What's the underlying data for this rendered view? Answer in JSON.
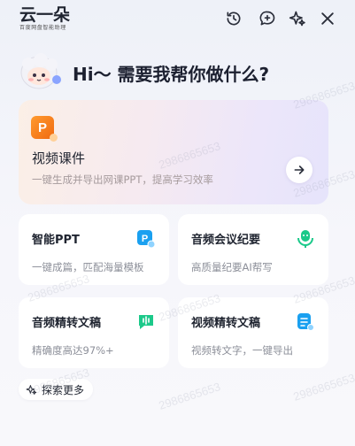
{
  "header": {
    "logo_text": "云一朵",
    "logo_sub": "百度网盘智能助理",
    "icons": [
      "history-icon",
      "new-chat-icon",
      "sparkle-icon",
      "close-icon"
    ]
  },
  "greeting": "Hi～ 需要我帮你做什么?",
  "hero": {
    "icon_letter": "P",
    "title": "视频课件",
    "subtitle": "一键生成并导出网课PPT，提高学习效率"
  },
  "cards": [
    {
      "title": "智能PPT",
      "desc": "一键成篇，匹配海量模板",
      "icon": "ppt-icon",
      "color": "#1aa0f0"
    },
    {
      "title": "音频会议纪要",
      "desc": "高质量纪要AI帮写",
      "icon": "mic-icon",
      "color": "#1cc98a"
    },
    {
      "title": "音频精转文稿",
      "desc": "精确度高达97%+",
      "icon": "audio-wave-icon",
      "color": "#1cc98a"
    },
    {
      "title": "视频精转文稿",
      "desc": "视频转文字，一键导出",
      "icon": "document-icon",
      "color": "#1aa0f0"
    }
  ],
  "explore_label": "探索更多",
  "watermark": "2986865653",
  "colors": {
    "accent_orange": "#f06a10",
    "accent_blue": "#1aa0f0",
    "accent_green": "#1cc98a"
  }
}
